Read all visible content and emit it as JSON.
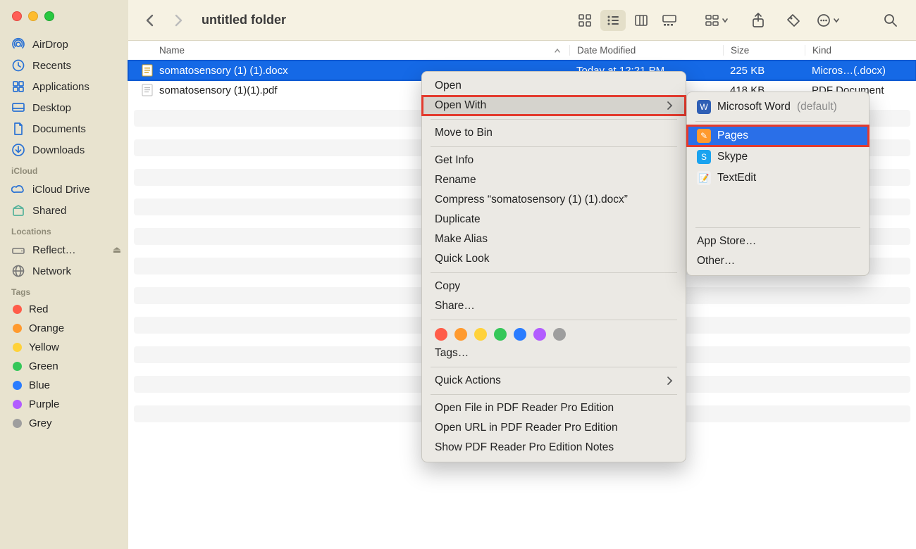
{
  "window": {
    "title": "untitled folder"
  },
  "sidebar": {
    "favorites": [
      {
        "label": "AirDrop",
        "icon": "airdrop"
      },
      {
        "label": "Recents",
        "icon": "clock"
      },
      {
        "label": "Applications",
        "icon": "apps"
      },
      {
        "label": "Desktop",
        "icon": "desktop"
      },
      {
        "label": "Documents",
        "icon": "doc"
      },
      {
        "label": "Downloads",
        "icon": "downloads"
      }
    ],
    "sections": {
      "icloud_label": "iCloud",
      "locations_label": "Locations",
      "tags_label": "Tags"
    },
    "icloud": [
      {
        "label": "iCloud Drive",
        "icon": "cloud"
      },
      {
        "label": "Shared",
        "icon": "shared"
      }
    ],
    "locations": [
      {
        "label": "Reflect…",
        "icon": "drive",
        "ejectable": true
      },
      {
        "label": "Network",
        "icon": "network"
      }
    ],
    "tags": [
      {
        "label": "Red",
        "color": "#ff5c49"
      },
      {
        "label": "Orange",
        "color": "#ff9a2e"
      },
      {
        "label": "Yellow",
        "color": "#ffd23a"
      },
      {
        "label": "Green",
        "color": "#35c759"
      },
      {
        "label": "Blue",
        "color": "#2a7cff"
      },
      {
        "label": "Purple",
        "color": "#b25cff"
      },
      {
        "label": "Grey",
        "color": "#9e9e9e"
      }
    ]
  },
  "columns": {
    "name": "Name",
    "date": "Date Modified",
    "size": "Size",
    "kind": "Kind"
  },
  "files": [
    {
      "name": "somatosensory (1) (1).docx",
      "date": "Today at 12:21 PM",
      "size": "225 KB",
      "kind": "Micros…(.docx)",
      "selected": true,
      "icon": "docx"
    },
    {
      "name": "somatosensory (1)(1).pdf",
      "date": "",
      "size": "418 KB",
      "kind": "PDF Document",
      "selected": false,
      "icon": "pdf"
    }
  ],
  "context_menu": {
    "open": "Open",
    "open_with": "Open With",
    "move_to_bin": "Move to Bin",
    "get_info": "Get Info",
    "rename": "Rename",
    "compress": "Compress “somatosensory (1) (1).docx”",
    "duplicate": "Duplicate",
    "make_alias": "Make Alias",
    "quick_look": "Quick Look",
    "copy": "Copy",
    "share": "Share…",
    "tags": "Tags…",
    "quick_actions": "Quick Actions",
    "open_file_pdf": "Open File in PDF Reader Pro Edition",
    "open_url_pdf": "Open URL in PDF Reader Pro Edition",
    "show_pdf_notes": "Show PDF Reader Pro Edition Notes",
    "tag_colors": [
      "#ff5c49",
      "#ff9a2e",
      "#ffd23a",
      "#35c759",
      "#2a7cff",
      "#b25cff",
      "#9e9e9e"
    ]
  },
  "open_with_submenu": {
    "items": [
      {
        "label": "Microsoft Word",
        "suffix": "(default)",
        "icon_bg": "#2f5fb5",
        "icon_text": "W"
      },
      {
        "label": "Pages",
        "icon_bg": "#ff9a2e",
        "icon_text": "✎",
        "selected": true
      },
      {
        "label": "Skype",
        "icon_bg": "#1aa3ef",
        "icon_text": "S"
      },
      {
        "label": "TextEdit",
        "icon_bg": "#f0f0f0",
        "icon_text": "📝"
      }
    ],
    "app_store": "App Store…",
    "other": "Other…"
  }
}
